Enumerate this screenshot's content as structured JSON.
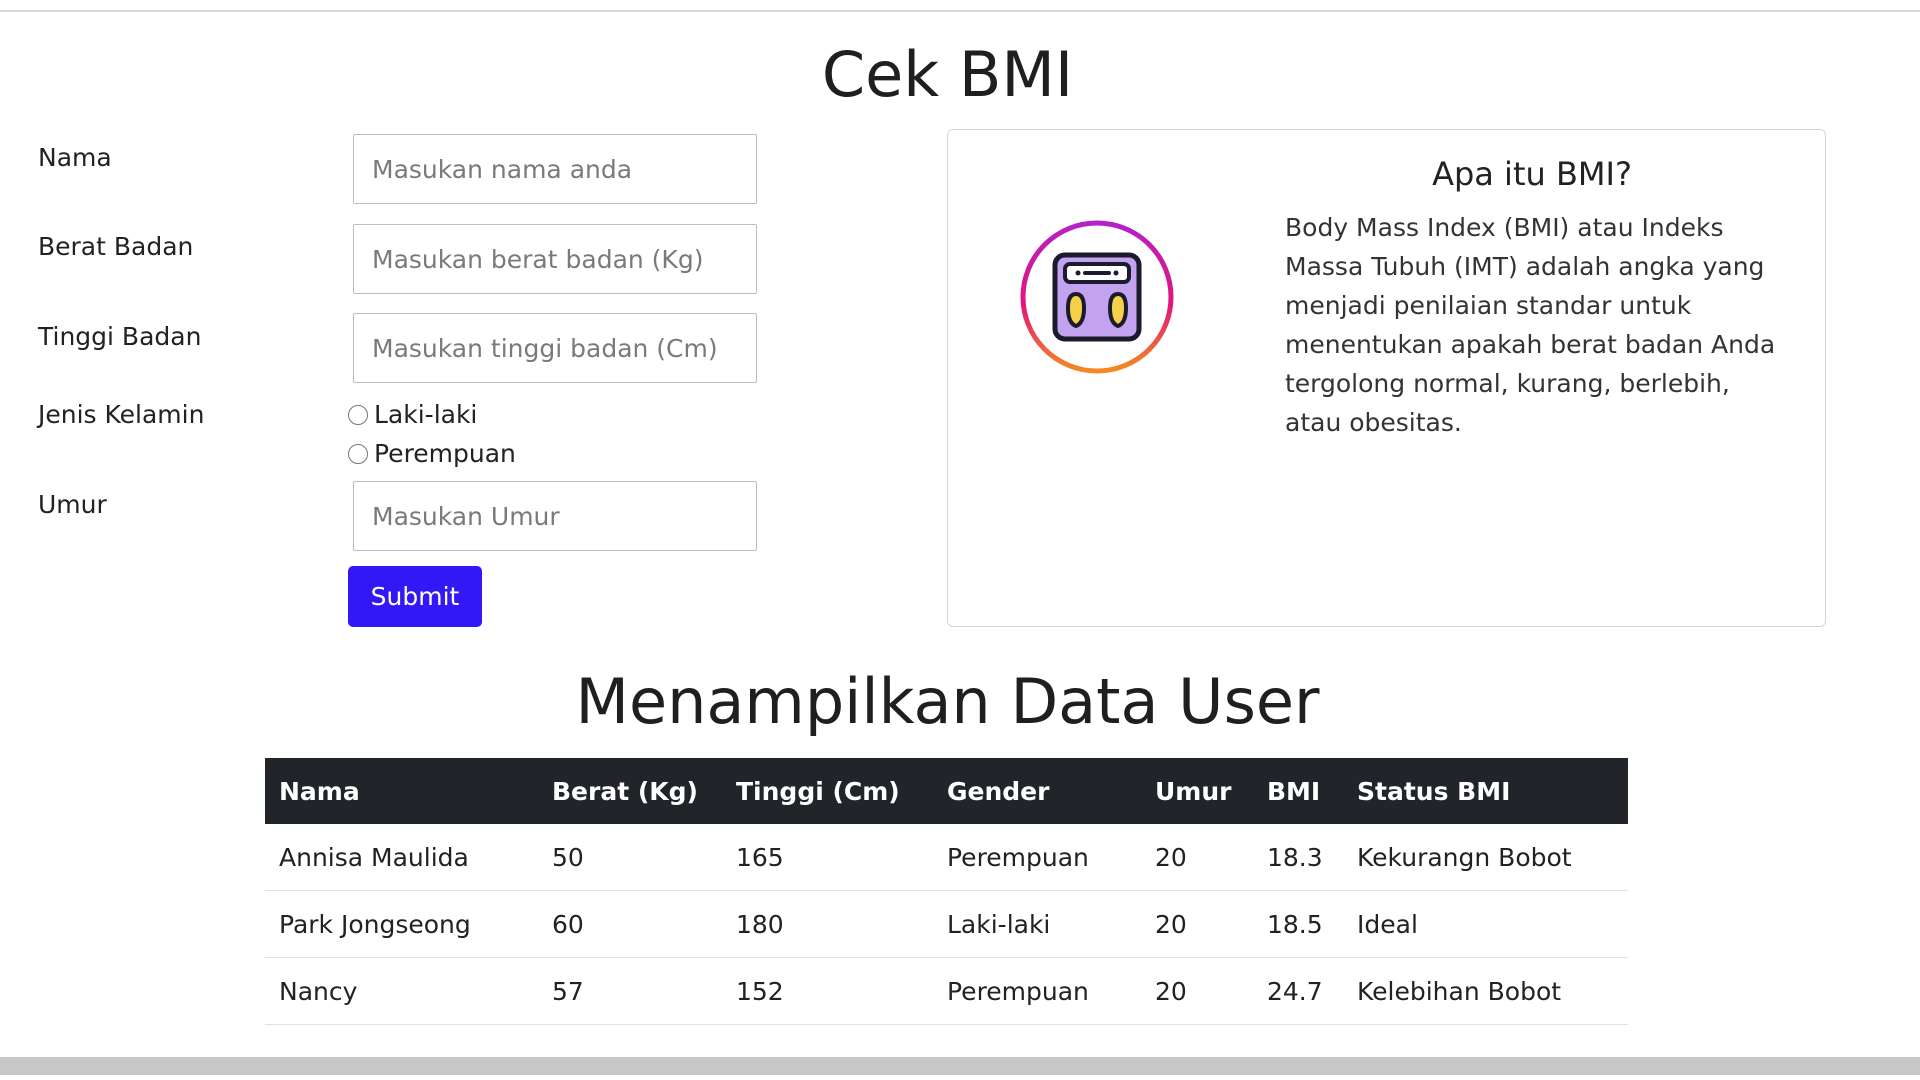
{
  "form": {
    "title": "Cek BMI",
    "fields": {
      "nama": {
        "label": "Nama",
        "placeholder": "Masukan nama anda"
      },
      "berat": {
        "label": "Berat Badan",
        "placeholder": "Masukan berat badan (Kg)"
      },
      "tinggi": {
        "label": "Tinggi Badan",
        "placeholder": "Masukan tinggi badan (Cm)"
      },
      "umur": {
        "label": "Umur",
        "placeholder": "Masukan Umur"
      }
    },
    "gender": {
      "label": "Jenis Kelamin",
      "options": [
        "Laki-laki",
        "Perempuan"
      ]
    },
    "submit_label": "Submit"
  },
  "info": {
    "title": "Apa itu BMI?",
    "text": "Body Mass Index (BMI) atau Indeks Massa Tubuh (IMT) adalah angka yang menjadi penilaian standar untuk menentukan apakah berat badan Anda tergolong normal, kurang, berlebih, atau obesitas.",
    "icon": "weight-scale-icon"
  },
  "table": {
    "title": "Menampilkan Data User",
    "headers": [
      "Nama",
      "Berat (Kg)",
      "Tinggi (Cm)",
      "Gender",
      "Umur",
      "BMI",
      "Status BMI"
    ],
    "rows": [
      [
        "Annisa Maulida",
        "50",
        "165",
        "Perempuan",
        "20",
        "18.3",
        "Kekurangn Bobot"
      ],
      [
        "Park Jongseong",
        "60",
        "180",
        "Laki-laki",
        "20",
        "18.5",
        "Ideal"
      ],
      [
        "Nancy",
        "57",
        "152",
        "Perempuan",
        "20",
        "24.7",
        "Kelebihan Bobot"
      ]
    ]
  },
  "colors": {
    "primary_button": "#3318f6",
    "table_header": "#212529"
  }
}
